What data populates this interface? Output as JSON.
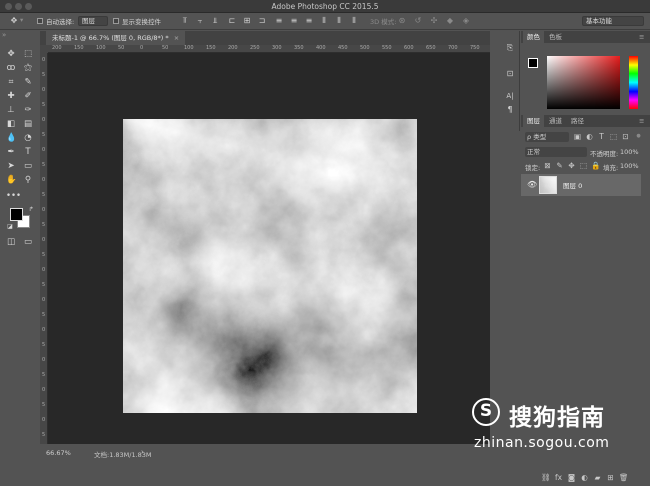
{
  "app": {
    "title": "Adobe Photoshop CC 2015.5"
  },
  "options_bar": {
    "auto_select_label": "自动选择:",
    "auto_select_value": "图层",
    "show_transform_label": "显示变换控件",
    "mode_3d_label": "3D 模式:",
    "workspace_value": "基本功能"
  },
  "document": {
    "tab_title": "未标题-1 @ 66.7% (图层 0, RGB/8*) *",
    "zoom": "66.67%",
    "doc_size": "文档:1.83M/1.83M"
  },
  "ruler": {
    "top_ticks": [
      "200",
      "150",
      "100",
      "50",
      "0",
      "50",
      "100",
      "150",
      "200",
      "250",
      "300",
      "350",
      "400",
      "450",
      "500",
      "550",
      "600",
      "650",
      "700",
      "750",
      "800"
    ],
    "left_ticks": [
      "0",
      "5",
      "0",
      "5",
      "0",
      "5",
      "0",
      "5",
      "0",
      "5",
      "0",
      "5",
      "0",
      "5",
      "0",
      "5",
      "0",
      "5",
      "0",
      "5",
      "0",
      "5",
      "0",
      "5",
      "0",
      "5"
    ]
  },
  "color_panel": {
    "tabs": [
      "颜色",
      "色板"
    ],
    "accent_red": "#e51d1d"
  },
  "layers_panel": {
    "tabs": [
      "图层",
      "通道",
      "路径"
    ],
    "filter_label": "ρ 类型",
    "blend_mode": "正常",
    "opacity_label": "不透明度:",
    "opacity_value": "100%",
    "lock_label": "锁定:",
    "fill_label": "填充:",
    "fill_value": "100%",
    "layers": [
      {
        "name": "图层 0",
        "visible": true
      }
    ],
    "footer_icons": [
      "link-icon",
      "fx-icon",
      "mask-icon",
      "adjustment-icon",
      "folder-icon",
      "new-layer-icon",
      "trash-icon"
    ]
  },
  "tools": [
    "move-icon",
    "marquee-icon",
    "lasso-icon",
    "magic-wand-icon",
    "crop-icon",
    "eyedropper-icon",
    "healing-icon",
    "brush-icon",
    "stamp-icon",
    "history-brush-icon",
    "eraser-icon",
    "gradient-icon",
    "blur-icon",
    "dodge-icon",
    "pen-icon",
    "type-icon",
    "path-select-icon",
    "shape-icon",
    "hand-icon",
    "zoom-icon"
  ],
  "watermark": {
    "logo_letter": "S",
    "name": "搜狗指南",
    "url": "zhinan.sogou.com"
  }
}
